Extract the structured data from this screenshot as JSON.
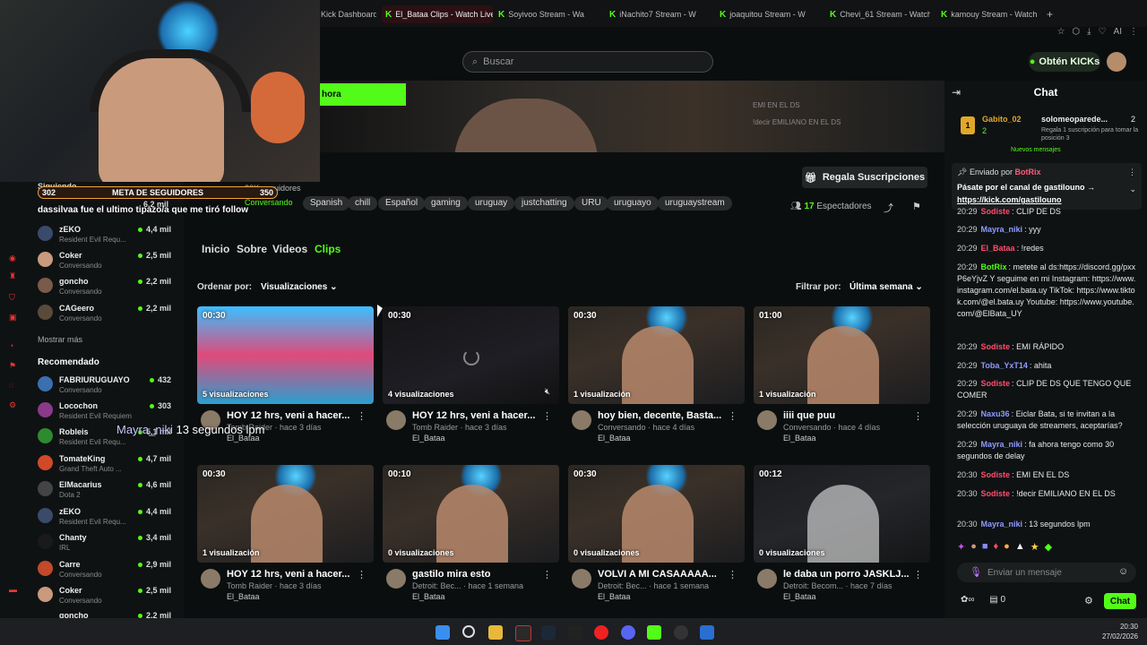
{
  "browser": {
    "tabs": [
      {
        "label": "Kick Dashboard",
        "active": false
      },
      {
        "label": "El_Bataa Clips - Watch Live",
        "active": true
      },
      {
        "label": "Soyivoo Stream - Wa",
        "active": false
      },
      {
        "label": "iNachito7 Stream - W",
        "active": false
      },
      {
        "label": "joaquitou Stream - W",
        "active": false
      },
      {
        "label": "Chevi_61 Stream - Watch",
        "active": false
      },
      {
        "label": "kamouy Stream - Watch",
        "active": false
      }
    ],
    "new_tab": "+",
    "ai_label": "AI"
  },
  "header": {
    "search_placeholder": "Buscar",
    "kicks_button": "Obtén KICKs"
  },
  "overlay": {
    "meta_left": "302",
    "meta_title": "META DE SEGUIDORES",
    "meta_right": "350",
    "follow_message": "dassilvaa fue el ultimo tipazo/a que me tiró follow",
    "mayra_name": "Mayra_niki",
    "mayra_msg": "13 segundos lpm"
  },
  "banner": {
    "button_label": "hora",
    "line1": "EMI EN EL DS",
    "line2": "!decir EMILIANO EN EL DS"
  },
  "sidebar": {
    "header": "Siguiendo",
    "following_count": "6,2 mil",
    "following": [
      {
        "name": "zEKO",
        "sub": "Resident Evil Requ...",
        "viewers": "4,4 mil"
      },
      {
        "name": "Coker",
        "sub": "Conversando",
        "viewers": "2,5 mil"
      },
      {
        "name": "goncho",
        "sub": "Conversando",
        "viewers": "2,2 mil"
      },
      {
        "name": "CAGeero",
        "sub": "Conversando",
        "viewers": "2,2 mil"
      }
    ],
    "show_more": "Mostrar más",
    "recommended_header": "Recomendado",
    "recommended": [
      {
        "name": "FABRIURUGUAYO",
        "sub": "Conversando",
        "viewers": "432"
      },
      {
        "name": "Locochon",
        "sub": "Resident Evil Requiem",
        "viewers": "303"
      },
      {
        "name": "Robleis",
        "sub": "Resident Evil Requ...",
        "viewers": "5,1 mil"
      },
      {
        "name": "TomateKing",
        "sub": "Grand Theft Auto ...",
        "viewers": "4,7 mil"
      },
      {
        "name": "ElMacarius",
        "sub": "Dota 2",
        "viewers": "4,6 mil"
      },
      {
        "name": "zEKO",
        "sub": "Resident Evil Requ...",
        "viewers": "4,4 mil"
      },
      {
        "name": "Chanty",
        "sub": "IRL",
        "viewers": "3,4 mil"
      },
      {
        "name": "Carre",
        "sub": "Conversando",
        "viewers": "2,9 mil"
      },
      {
        "name": "Coker",
        "sub": "Conversando",
        "viewers": "2,5 mil"
      },
      {
        "name": "goncho",
        "sub": "",
        "viewers": "2,2 mil"
      }
    ]
  },
  "channel": {
    "followers": "30K seguidores",
    "category": "Conversando",
    "tags": [
      "Spanish",
      "chill",
      "Español",
      "gaming",
      "uruguay",
      "justchatting",
      "URU",
      "uruguayo",
      "uruguaystream"
    ],
    "gift_button": "Regala Suscripciones",
    "viewers_count": "17",
    "viewers_label": "Espectadores"
  },
  "nav": {
    "tabs": [
      "Inicio",
      "Sobre",
      "Videos",
      "Clips"
    ],
    "active": "Clips",
    "sort_label": "Ordenar por:",
    "sort_value": "Visualizaciones",
    "filter_label": "Filtrar por:",
    "filter_value": "Última semana"
  },
  "clips": [
    {
      "duration": "00:30",
      "views": "5 visualizaciones",
      "title": "HOY 12 hrs, veni a hacer...",
      "meta": "Tomb Raider · hace 3 días",
      "channel": "El_Bataa"
    },
    {
      "duration": "00:30",
      "views": "4 visualizaciones",
      "title": "HOY 12 hrs, veni a hacer...",
      "meta": "Tomb Raider · hace 3 días",
      "channel": "El_Bataa"
    },
    {
      "duration": "00:30",
      "views": "1 visualización",
      "title": "hoy bien, decente, Basta...",
      "meta": "Conversando · hace 4 días",
      "channel": "El_Bataa"
    },
    {
      "duration": "01:00",
      "views": "1 visualización",
      "title": "iiii que puu",
      "meta": "Conversando · hace 4 días",
      "channel": "El_Bataa"
    },
    {
      "duration": "00:30",
      "views": "1 visualización",
      "title": "HOY 12 hrs, veni a hacer...",
      "meta": "Tomb Raider · hace 3 días",
      "channel": "El_Bataa"
    },
    {
      "duration": "00:10",
      "views": "0 visualizaciones",
      "title": "gastilo mira esto",
      "meta": "Detroit: Bec... · hace 1 semana",
      "channel": "El_Bataa"
    },
    {
      "duration": "00:30",
      "views": "0 visualizaciones",
      "title": "VOLVI A MI CASAAAAA...",
      "meta": "Detroit: Bec... · hace 1 semana",
      "channel": "El_Bataa"
    },
    {
      "duration": "00:12",
      "views": "0 visualizaciones",
      "title": "le daba un porro JASKLJ...",
      "meta": "Detroit: Becom... · hace 7 días",
      "channel": "El_Bataa"
    }
  ],
  "chat": {
    "title": "Chat",
    "leader_user": "Gabito_02",
    "leader_count": "2",
    "leader_sub_user": "solomeoparede...",
    "leader_sub_count": "2",
    "leader_sub_text": "Regala 1 suscripción para tomar la posición 3",
    "new_messages": "Nuevos mensajes",
    "pinned_by": "Enviado por",
    "pinned_user": "BotRix",
    "pinned_text": "Pásate por el canal de gastilouno →",
    "pinned_link": "https://kick.com/gastilouno",
    "messages": [
      {
        "time": "20:29",
        "user": "Sodiste",
        "color": "#ff4d6d",
        "text": "CLIP DE DS"
      },
      {
        "time": "20:29",
        "user": "Mayra_niki",
        "color": "#8f9bff",
        "text": "yyy"
      },
      {
        "time": "20:29",
        "user": "El_Bataa",
        "color": "#ff4d6d",
        "text": "!redes"
      },
      {
        "time": "20:29",
        "user": "BotRix",
        "color": "#53fc18",
        "text": "metete al ds:https://discord.gg/pxxP6eYjvZ Y seguime en mi Instagram: https://www.instagram.com/el.bata.uy TikTok: https://www.tiktok.com/@el.bata.uy Youtube: https://www.youtube.com/@ElBata_UY"
      },
      {
        "time": "20:29",
        "user": "Sodiste",
        "color": "#ff4d6d",
        "text": "EMI RÁPIDO"
      },
      {
        "time": "20:29",
        "user": "Toba_YxT14",
        "color": "#8f9bff",
        "text": "ahita"
      },
      {
        "time": "20:29",
        "user": "Sodiste",
        "color": "#ff4d6d",
        "text": "CLIP DE DS QUE TENGO QUE COMER"
      },
      {
        "time": "20:29",
        "user": "Naxu36",
        "color": "#8f9bff",
        "text": "Eiclar Bata, si te invitan a la selección uruguaya de streamers, aceptarías?"
      },
      {
        "time": "20:29",
        "user": "Mayra_niki",
        "color": "#8f9bff",
        "text": "fa ahora tengo como 30 segundos de delay"
      },
      {
        "time": "20:30",
        "user": "Sodiste",
        "color": "#ff4d6d",
        "text": "EMI EN EL DS"
      },
      {
        "time": "20:30",
        "user": "Sodiste",
        "color": "#ff4d6d",
        "text": "!decir EMILIANO EN EL DS"
      },
      {
        "time": "20:30",
        "user": "Mayra_niki",
        "color": "#8f9bff",
        "text": "13 segundos lpm"
      }
    ],
    "input_placeholder": "Enviar un mensaje",
    "points": "0",
    "send_label": "Chat"
  },
  "taskbar": {
    "time": "20:30",
    "date": "27/02/2026"
  },
  "colors": {
    "accent": "#53fc18",
    "background": "#0b0e0f",
    "meta_border": "#f2a33a"
  }
}
